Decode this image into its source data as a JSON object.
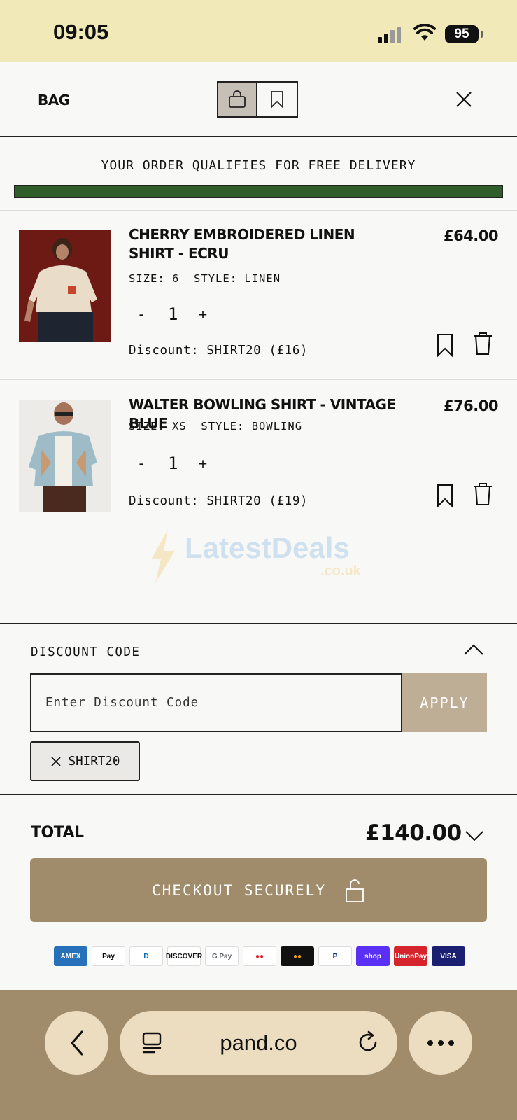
{
  "status": {
    "time": "09:05",
    "battery": "95"
  },
  "header": {
    "title": "BAG"
  },
  "delivery": {
    "message": "YOUR ORDER QUALIFIES FOR FREE DELIVERY",
    "progress": 1.0
  },
  "items": [
    {
      "name": "CHERRY EMBROIDERED LINEN SHIRT - ECRU",
      "price": "£64.00",
      "size_label": "SIZE:",
      "size": "6",
      "style_label": "STYLE:",
      "style": "LINEN",
      "qty_minus": "-",
      "qty": "1",
      "qty_plus": "+",
      "discount": "Discount: SHIRT20 (£16)"
    },
    {
      "name": "WALTER BOWLING SHIRT - VINTAGE BLUE",
      "price": "£76.00",
      "size_label": "SIZE:",
      "size": "XS",
      "style_label": "STYLE:",
      "style": "BOWLING",
      "qty_minus": "-",
      "qty": "1",
      "qty_plus": "+",
      "discount": "Discount: SHIRT20 (£19)"
    }
  ],
  "watermark": {
    "brand": "LatestDeals",
    "suffix": ".co.uk"
  },
  "discount_section": {
    "title": "DISCOUNT CODE",
    "input_placeholder": "Enter Discount Code",
    "apply_label": "APPLY",
    "applied_code": "SHIRT20"
  },
  "total": {
    "label": "TOTAL",
    "value": "£140.00"
  },
  "checkout": {
    "label": "CHECKOUT SECURELY"
  },
  "payments": [
    {
      "name": "AMEX",
      "bg": "#2671b9",
      "fg": "#ffffff"
    },
    {
      "name": "Pay",
      "bg": "#ffffff",
      "fg": "#000000"
    },
    {
      "name": "D",
      "bg": "#ffffff",
      "fg": "#0067b1"
    },
    {
      "name": "DISCOVER",
      "bg": "#ffffff",
      "fg": "#111111"
    },
    {
      "name": "G Pay",
      "bg": "#ffffff",
      "fg": "#5f6368"
    },
    {
      "name": "●●",
      "bg": "#ffffff",
      "fg": "#d8232a"
    },
    {
      "name": "●●",
      "bg": "#111111",
      "fg": "#f79e1b"
    },
    {
      "name": "P",
      "bg": "#ffffff",
      "fg": "#003087"
    },
    {
      "name": "shop",
      "bg": "#5a31f4",
      "fg": "#ffffff"
    },
    {
      "name": "UnionPay",
      "bg": "#d6242d",
      "fg": "#ffffff"
    },
    {
      "name": "VISA",
      "bg": "#1a1f71",
      "fg": "#ffffff"
    }
  ],
  "browser": {
    "url": "pand.co"
  },
  "colors": {
    "accent": "#a08c6a",
    "progress": "#2f5e2a",
    "status_bar": "#f1e9b8"
  }
}
